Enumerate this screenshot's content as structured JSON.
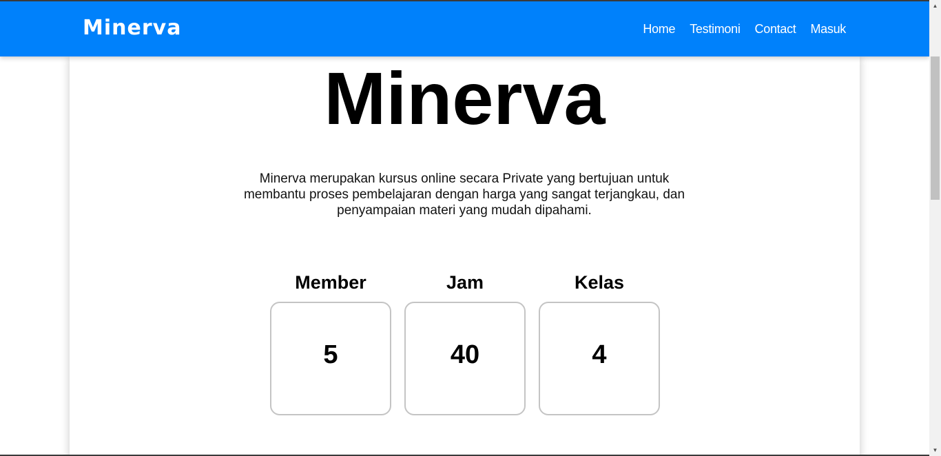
{
  "navbar": {
    "logo_text": "Minerva",
    "links": [
      {
        "label": "Home"
      },
      {
        "label": "Testimoni"
      },
      {
        "label": "Contact"
      },
      {
        "label": "Masuk"
      }
    ],
    "background": "#0081fb"
  },
  "hero": {
    "title": "Minerva",
    "description": "Minerva merupakan kursus online secara Private yang bertujuan untuk membantu proses pembelajaran dengan harga yang sangat terjangkau, dan penyampaian materi yang mudah dipahami."
  },
  "stats": [
    {
      "label": "Member",
      "value": "5"
    },
    {
      "label": "Jam",
      "value": "40"
    },
    {
      "label": "Kelas",
      "value": "4"
    }
  ],
  "icons": {
    "scroll_up": "scroll-up-arrow-icon",
    "scroll_down": "scroll-down-arrow-icon"
  }
}
